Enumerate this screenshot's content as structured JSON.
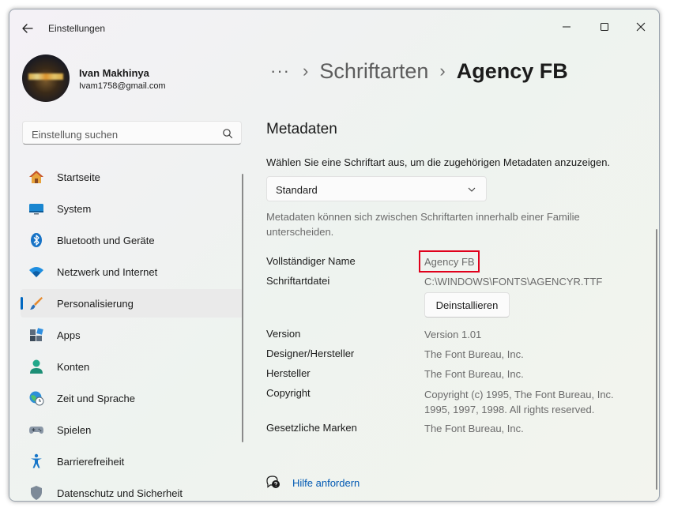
{
  "window": {
    "title": "Einstellungen"
  },
  "user": {
    "name": "Ivan Makhinya",
    "email": "Ivam1758@gmail.com"
  },
  "search": {
    "placeholder": "Einstellung suchen"
  },
  "sidebar": {
    "items": [
      {
        "label": "Startseite",
        "icon": "home-icon"
      },
      {
        "label": "System",
        "icon": "system-icon"
      },
      {
        "label": "Bluetooth und Geräte",
        "icon": "bluetooth-icon"
      },
      {
        "label": "Netzwerk und Internet",
        "icon": "network-icon"
      },
      {
        "label": "Personalisierung",
        "icon": "personalization-icon",
        "active": true
      },
      {
        "label": "Apps",
        "icon": "apps-icon"
      },
      {
        "label": "Konten",
        "icon": "accounts-icon"
      },
      {
        "label": "Zeit und Sprache",
        "icon": "time-language-icon"
      },
      {
        "label": "Spielen",
        "icon": "gaming-icon"
      },
      {
        "label": "Barrierefreiheit",
        "icon": "accessibility-icon"
      },
      {
        "label": "Datenschutz und Sicherheit",
        "icon": "privacy-shield-icon"
      }
    ]
  },
  "breadcrumb": {
    "ellipsis": "···",
    "separator": "›",
    "parent": "Schriftarten",
    "current": "Agency FB"
  },
  "metadata": {
    "title": "Metadaten",
    "description": "Wählen Sie eine Schriftart aus, um die zugehörigen Metadaten anzuzeigen.",
    "dropdown_value": "Standard",
    "note": "Metadaten können sich zwischen Schriftarten innerhalb einer Familie unterscheiden.",
    "full_name_label": "Vollständiger Name",
    "full_name_value": "Agency FB",
    "file_label": "Schriftartdatei",
    "file_value": "C:\\WINDOWS\\FONTS\\AGENCYR.TTF",
    "uninstall_label": "Deinstallieren",
    "version_label": "Version",
    "version_value": "Version 1.01",
    "designer_label": "Designer/Hersteller",
    "designer_value": "The Font Bureau, Inc.",
    "manufacturer_label": "Hersteller",
    "manufacturer_value": "The Font Bureau, Inc.",
    "copyright_label": "Copyright",
    "copyright_value_line1": "Copyright (c) 1995, The Font Bureau, Inc.",
    "copyright_value_line2": "1995, 1997, 1998.  All rights reserved.",
    "trademark_label": "Gesetzliche Marken",
    "trademark_value": "The Font Bureau, Inc."
  },
  "help": {
    "label": "Hilfe anfordern"
  },
  "colors": {
    "accent": "#0067c0",
    "highlight": "#e0001b",
    "link": "#0059b3"
  }
}
